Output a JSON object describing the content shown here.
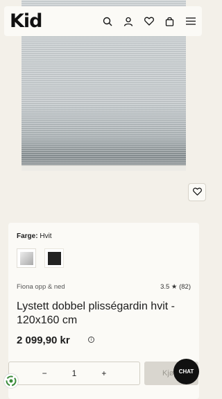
{
  "header": {
    "logo_text": "Kid",
    "icons": [
      "search-icon",
      "user-icon",
      "heart-icon",
      "bag-icon",
      "menu-icon"
    ]
  },
  "product": {
    "color_label": "Farge:",
    "color_value": "Hvit",
    "swatches": [
      {
        "name": "Hvit",
        "color": "#cfcfcf"
      },
      {
        "name": "Sort",
        "color": "#222222"
      }
    ],
    "brand": "Fiona opp & ned",
    "rating": "3.5",
    "rating_star": "★",
    "review_count": "(82)",
    "title": "Lystett dobbel plisségardin hvit - 120x160 cm",
    "price": "2 099,90 kr"
  },
  "purchase": {
    "qty_minus": "−",
    "qty_value": "1",
    "qty_plus": "+",
    "buy_label": "Kjøp"
  },
  "chat": {
    "label": "CHAT"
  },
  "colors": {
    "background": "#f3f0e9",
    "card": "#fbfaf6",
    "chat": "#111111",
    "badge": "#3b8b3b"
  }
}
